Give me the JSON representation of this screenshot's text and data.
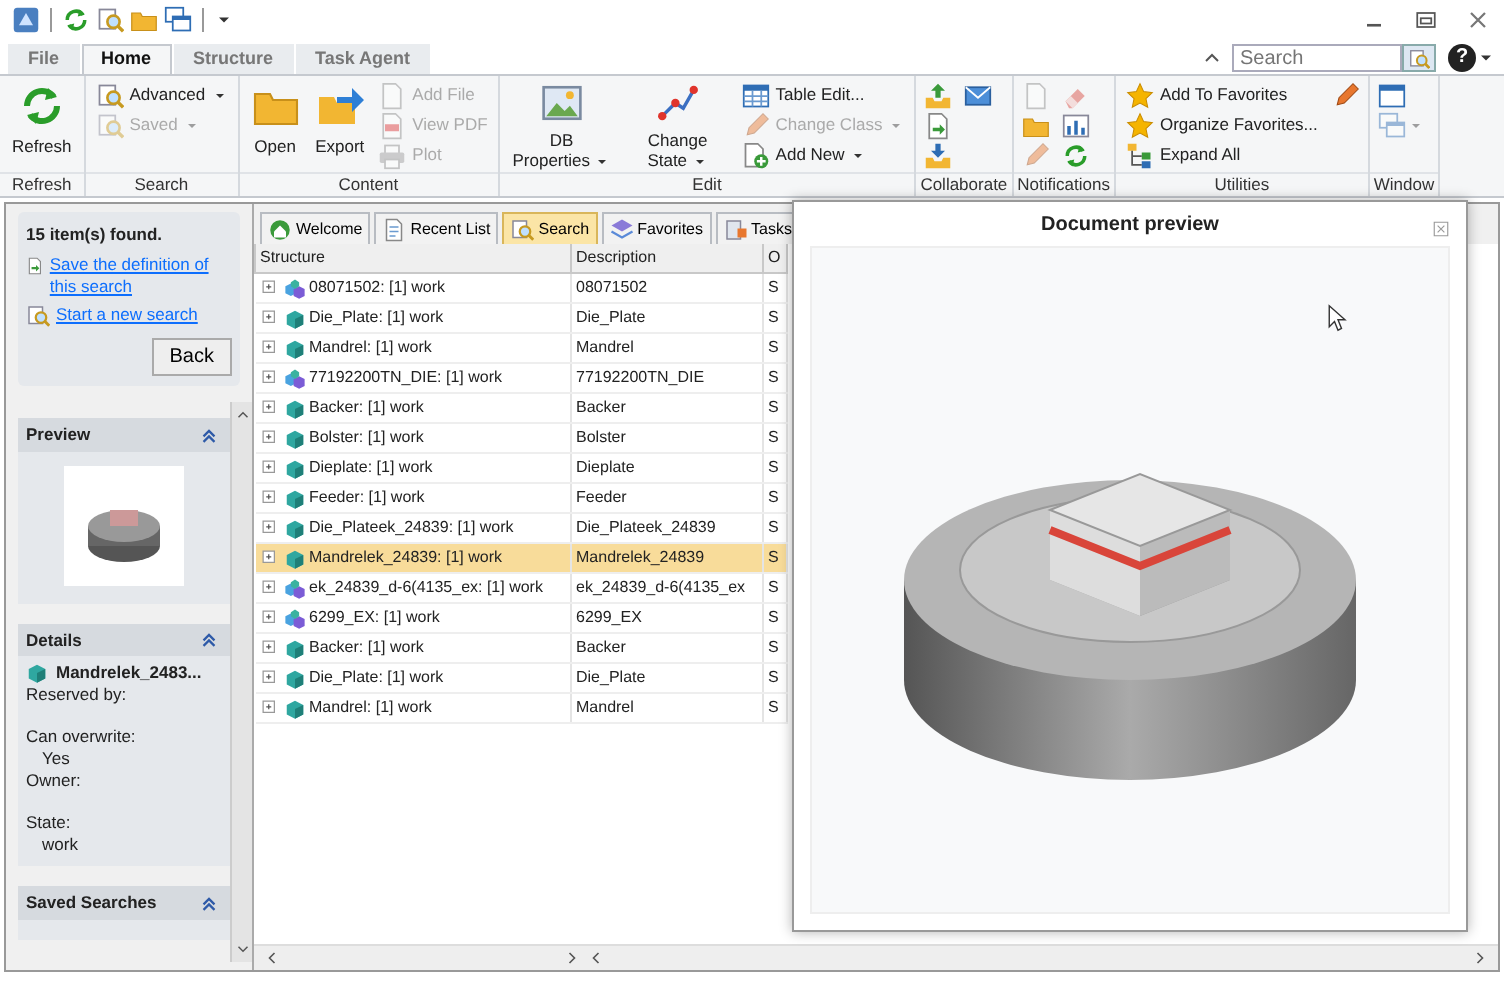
{
  "ribbon_tabs": [
    {
      "label": "File",
      "selected": false
    },
    {
      "label": "Home",
      "selected": true
    },
    {
      "label": "Structure",
      "selected": false
    },
    {
      "label": "Task Agent",
      "selected": false
    }
  ],
  "search": {
    "placeholder": "Search"
  },
  "help_button": "?",
  "ribbon": {
    "groups": [
      {
        "label": "Refresh",
        "items": [
          {
            "kind": "large",
            "label": "Refresh",
            "disabled": false,
            "dropdown": false
          }
        ]
      },
      {
        "label": "Search",
        "items": [
          {
            "kind": "small",
            "label": "Advanced",
            "disabled": false,
            "dropdown": true
          },
          {
            "kind": "small",
            "label": "Saved",
            "disabled": true,
            "dropdown": true
          }
        ]
      },
      {
        "label": "Content",
        "items": [
          {
            "kind": "large",
            "label": "Open",
            "disabled": false,
            "dropdown": false
          },
          {
            "kind": "large",
            "label": "Export",
            "disabled": false,
            "dropdown": false
          },
          {
            "kind": "small",
            "label": "Add File",
            "disabled": true,
            "dropdown": false
          },
          {
            "kind": "small",
            "label": "View PDF",
            "disabled": true,
            "dropdown": false
          },
          {
            "kind": "small",
            "label": "Plot",
            "disabled": true,
            "dropdown": false
          }
        ]
      },
      {
        "label": "Edit",
        "items": [
          {
            "kind": "large",
            "label": "DB Properties",
            "disabled": false,
            "dropdown": true
          },
          {
            "kind": "large",
            "label": "Change State",
            "disabled": false,
            "dropdown": true
          },
          {
            "kind": "small",
            "label": "Table Edit...",
            "disabled": false,
            "dropdown": false
          },
          {
            "kind": "small",
            "label": "Change Class",
            "disabled": true,
            "dropdown": true
          },
          {
            "kind": "small",
            "label": "Add New",
            "disabled": false,
            "dropdown": true
          }
        ]
      },
      {
        "label": "Collaborate",
        "items": [
          {
            "kind": "icon",
            "disabled": false,
            "dropdown": false
          },
          {
            "kind": "icon",
            "disabled": false,
            "dropdown": false
          },
          {
            "kind": "icon",
            "disabled": false,
            "dropdown": false
          },
          {
            "kind": "icon",
            "disabled": false,
            "dropdown": false
          }
        ]
      },
      {
        "label": "Notifications",
        "items": [
          {
            "kind": "icon",
            "disabled": true,
            "dropdown": false
          },
          {
            "kind": "icon",
            "disabled": false,
            "dropdown": false
          },
          {
            "kind": "icon",
            "disabled": true,
            "dropdown": false
          },
          {
            "kind": "icon",
            "disabled": true,
            "dropdown": false
          },
          {
            "kind": "icon",
            "disabled": false,
            "dropdown": false
          },
          {
            "kind": "icon",
            "disabled": false,
            "dropdown": false
          }
        ]
      },
      {
        "label": "Utilities",
        "items": [
          {
            "kind": "small",
            "label": "Add To Favorites",
            "disabled": false,
            "dropdown": false
          },
          {
            "kind": "small",
            "label": "Organize Favorites...",
            "disabled": false,
            "dropdown": false
          },
          {
            "kind": "small",
            "label": "Expand All",
            "disabled": false,
            "dropdown": false
          },
          {
            "kind": "icon",
            "disabled": false,
            "dropdown": false
          }
        ]
      },
      {
        "label": "Window",
        "items": [
          {
            "kind": "icon",
            "disabled": false,
            "dropdown": false
          },
          {
            "kind": "icon",
            "disabled": true,
            "dropdown": true
          }
        ]
      }
    ]
  },
  "sidebar": {
    "results": {
      "summary": "15 item(s) found.",
      "links": [
        "Save the definition of this search",
        "Start a new search"
      ],
      "back_button": "Back"
    },
    "panels": [
      {
        "kind": "preview",
        "title": "Preview"
      },
      {
        "kind": "details",
        "title": "Details",
        "item": "Mandrelek_2483...",
        "fields": [
          {
            "label": "Reserved by:"
          },
          {
            "label": "Can overwrite:",
            "value": "Yes"
          },
          {
            "label": "Owner:"
          },
          {
            "label": "State:",
            "value": "work"
          }
        ]
      },
      {
        "kind": "saved",
        "title": "Saved Searches"
      }
    ]
  },
  "content_tabs": [
    {
      "label": "Welcome",
      "selected": false
    },
    {
      "label": "Recent List",
      "selected": false
    },
    {
      "label": "Search",
      "selected": true
    },
    {
      "label": "Favorites",
      "selected": false
    },
    {
      "label": "Tasks",
      "selected": false
    }
  ],
  "table": {
    "columns": [
      "Structure",
      "Description",
      "O"
    ],
    "rows": [
      {
        "kind": "assembly",
        "structure": "08071502: [1] work",
        "description": "08071502",
        "column_3": "S",
        "selected": false
      },
      {
        "kind": "part",
        "structure": "Die_Plate: [1] work",
        "description": "Die_Plate",
        "column_3": "S",
        "selected": false
      },
      {
        "kind": "part",
        "structure": "Mandrel: [1] work",
        "description": "Mandrel",
        "column_3": "S",
        "selected": false
      },
      {
        "kind": "assembly",
        "structure": "77192200TN_DIE: [1] work",
        "description": "77192200TN_DIE",
        "column_3": "S",
        "selected": false
      },
      {
        "kind": "part",
        "structure": "Backer: [1] work",
        "description": "Backer",
        "column_3": "S",
        "selected": false
      },
      {
        "kind": "part",
        "structure": "Bolster: [1] work",
        "description": "Bolster",
        "column_3": "S",
        "selected": false
      },
      {
        "kind": "part",
        "structure": "Dieplate: [1] work",
        "description": "Dieplate",
        "column_3": "S",
        "selected": false
      },
      {
        "kind": "part",
        "structure": "Feeder: [1] work",
        "description": "Feeder",
        "column_3": "S",
        "selected": false
      },
      {
        "kind": "part",
        "structure": "Die_Plateek_24839: [1] work",
        "description": "Die_Plateek_24839",
        "column_3": "S",
        "selected": false
      },
      {
        "kind": "part",
        "structure": "Mandrelek_24839: [1] work",
        "description": "Mandrelek_24839",
        "column_3": "S",
        "selected": true
      },
      {
        "kind": "assembly",
        "structure": "ek_24839_d-6(4135_ex: [1] work",
        "description": "ek_24839_d-6(4135_ex",
        "column_3": "S",
        "selected": false
      },
      {
        "kind": "assembly",
        "structure": "6299_EX: [1] work",
        "description": "6299_EX",
        "column_3": "S",
        "selected": false
      },
      {
        "kind": "part",
        "structure": "Backer: [1] work",
        "description": "Backer",
        "column_3": "S",
        "selected": false
      },
      {
        "kind": "part",
        "structure": "Die_Plate: [1] work",
        "description": "Die_Plate",
        "column_3": "S",
        "selected": false
      },
      {
        "kind": "part",
        "structure": "Mandrel: [1] work",
        "description": "Mandrel",
        "column_3": "S",
        "selected": false
      }
    ]
  },
  "preview_window": {
    "title": "Document preview"
  }
}
